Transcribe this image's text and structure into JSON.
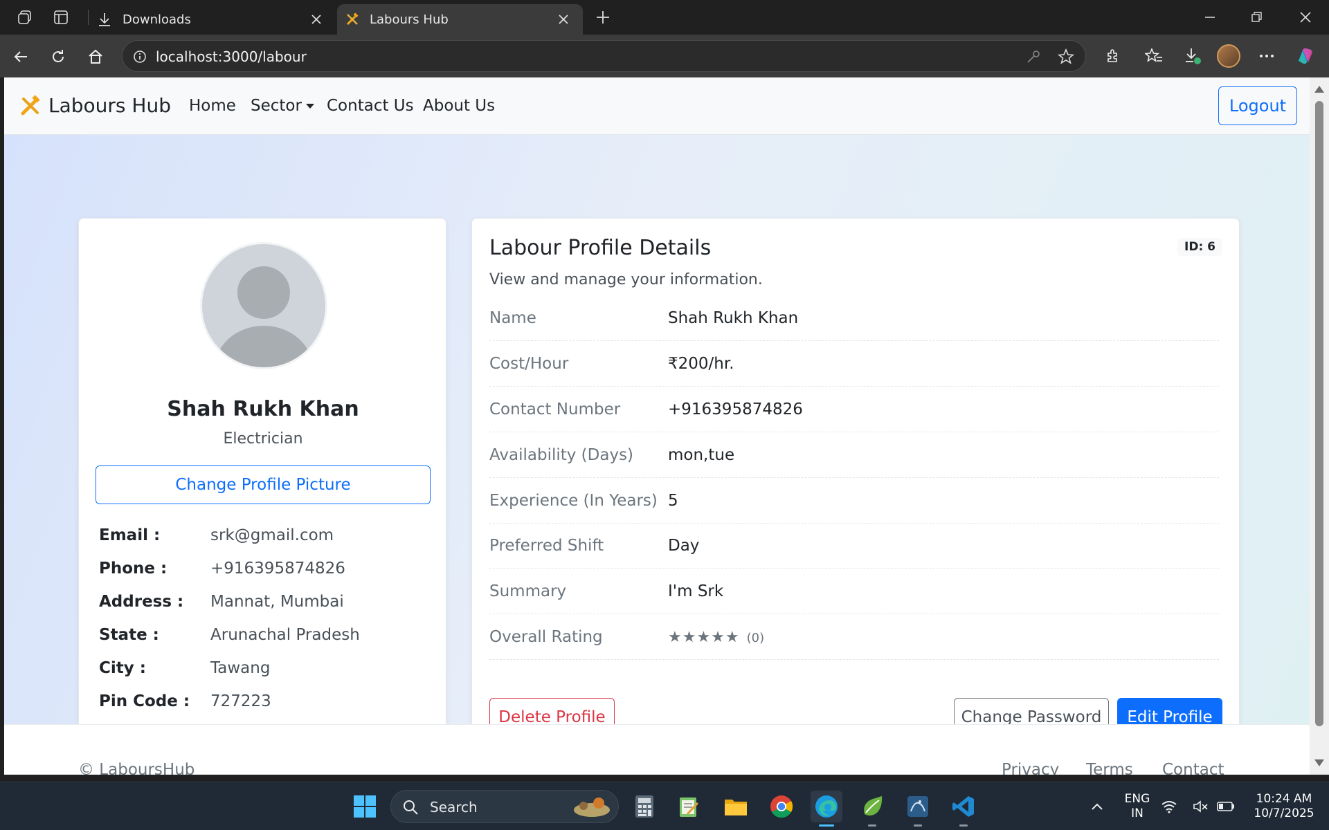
{
  "browser": {
    "tabs": [
      {
        "label": "Downloads",
        "active": false
      },
      {
        "label": "Labours Hub",
        "active": true
      }
    ],
    "url": "localhost:3000/labour"
  },
  "navbar": {
    "brand": "Labours Hub",
    "links": [
      "Home",
      "Sector",
      "Contact Us",
      "About Us"
    ],
    "logout_label": "Logout"
  },
  "profile_card": {
    "name": "Shah Rukh Khan",
    "role": "Electrician",
    "change_picture_label": "Change Profile Picture",
    "info": [
      {
        "key": "Email :",
        "value": "srk@gmail.com"
      },
      {
        "key": "Phone :",
        "value": "+916395874826"
      },
      {
        "key": "Address :",
        "value": "Mannat, Mumbai"
      },
      {
        "key": "State :",
        "value": "Arunachal Pradesh"
      },
      {
        "key": "City :",
        "value": "Tawang"
      },
      {
        "key": "Pin Code :",
        "value": "727223"
      }
    ]
  },
  "details_card": {
    "title": "Labour Profile Details",
    "id_badge": "ID: 6",
    "subtitle": "View and manage your information.",
    "rows": [
      {
        "key": "Name",
        "value": "Shah Rukh Khan"
      },
      {
        "key": "Cost/Hour",
        "value": "₹200/hr."
      },
      {
        "key": "Contact Number",
        "value": "+916395874826"
      },
      {
        "key": "Availability (Days)",
        "value": "mon,tue"
      },
      {
        "key": "Experience (In Years)",
        "value": "5"
      },
      {
        "key": "Preferred Shift",
        "value": "Day"
      },
      {
        "key": "Summary",
        "value": "I'm Srk"
      },
      {
        "key": "Overall Rating",
        "value": ""
      }
    ],
    "rating": {
      "stars": "★★★★★",
      "count": "(0)"
    },
    "buttons": {
      "delete": "Delete Profile",
      "change_password": "Change Password",
      "edit": "Edit Profile"
    }
  },
  "footer": {
    "copyright": "© LaboursHub",
    "links": [
      "Privacy",
      "Terms",
      "Contact"
    ]
  },
  "taskbar": {
    "search_label": "Search",
    "lang_line1": "ENG",
    "lang_line2": "IN",
    "time": "10:24 AM",
    "date": "10/7/2025"
  },
  "colors": {
    "primary": "#0d6efd",
    "danger": "#dc3545",
    "secondary": "#6c757d"
  }
}
